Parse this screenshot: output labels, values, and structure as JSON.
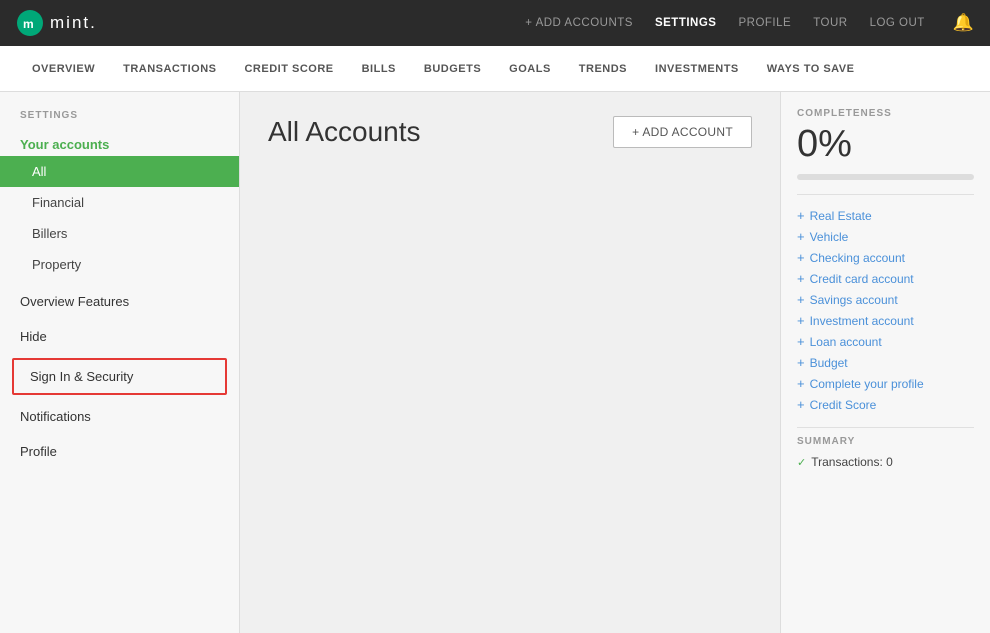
{
  "topNav": {
    "logoText": "mint.",
    "links": [
      {
        "id": "add-accounts",
        "label": "+ ADD ACCOUNTS",
        "active": false
      },
      {
        "id": "settings",
        "label": "SETTINGS",
        "active": true
      },
      {
        "id": "profile",
        "label": "PROFILE",
        "active": false
      },
      {
        "id": "tour",
        "label": "TOUR",
        "active": false
      },
      {
        "id": "log-out",
        "label": "LOG OUT",
        "active": false
      }
    ]
  },
  "secondNav": {
    "items": [
      {
        "id": "overview",
        "label": "OVERVIEW"
      },
      {
        "id": "transactions",
        "label": "TRANSACTIONS"
      },
      {
        "id": "credit-score",
        "label": "CREDIT SCORE"
      },
      {
        "id": "bills",
        "label": "BILLS"
      },
      {
        "id": "budgets",
        "label": "BUDGETS"
      },
      {
        "id": "goals",
        "label": "GOALS"
      },
      {
        "id": "trends",
        "label": "TRENDS"
      },
      {
        "id": "investments",
        "label": "INVESTMENTS"
      },
      {
        "id": "ways-to-save",
        "label": "WAYS TO SAVE"
      }
    ]
  },
  "sidebar": {
    "sectionLabel": "SETTINGS",
    "yourAccountsLabel": "Your accounts",
    "items": [
      {
        "id": "all",
        "label": "All",
        "active": true
      },
      {
        "id": "financial",
        "label": "Financial",
        "active": false
      },
      {
        "id": "billers",
        "label": "Billers",
        "active": false
      },
      {
        "id": "property",
        "label": "Property",
        "active": false
      }
    ],
    "overviewFeatures": "Overview Features",
    "hide": "Hide",
    "signInSecurity": "Sign In & Security",
    "notifications": "Notifications",
    "profile": "Profile"
  },
  "content": {
    "title": "All Accounts",
    "addAccountBtn": "+ ADD ACCOUNT"
  },
  "rightPanel": {
    "completenessLabel": "COMPLETENESS",
    "completenessPercent": "0%",
    "completenessValue": 0,
    "links": [
      {
        "id": "real-estate",
        "label": "Real Estate"
      },
      {
        "id": "vehicle",
        "label": "Vehicle"
      },
      {
        "id": "checking-account",
        "label": "Checking account"
      },
      {
        "id": "credit-card-account",
        "label": "Credit card account"
      },
      {
        "id": "savings-account",
        "label": "Savings account"
      },
      {
        "id": "investment-account",
        "label": "Investment account"
      },
      {
        "id": "loan-account",
        "label": "Loan account"
      },
      {
        "id": "budget",
        "label": "Budget"
      },
      {
        "id": "complete-profile",
        "label": "Complete your profile"
      },
      {
        "id": "credit-score",
        "label": "Credit Score"
      }
    ],
    "summaryLabel": "SUMMARY",
    "summaryItems": [
      {
        "id": "transactions",
        "label": "Transactions: 0"
      }
    ]
  }
}
